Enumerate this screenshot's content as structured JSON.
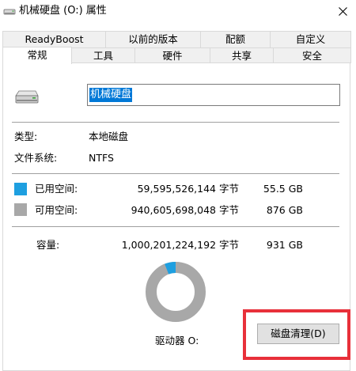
{
  "window": {
    "title": "机械硬盘 (O:) 属性"
  },
  "tabs": {
    "row1": [
      "ReadyBoost",
      "以前的版本",
      "配额",
      "自定义"
    ],
    "row2": [
      "常规",
      "工具",
      "硬件",
      "共享",
      "安全"
    ],
    "active": "常规"
  },
  "general": {
    "drive_name": "机械硬盘",
    "type_label": "类型:",
    "type_value": "本地磁盘",
    "fs_label": "文件系统:",
    "fs_value": "NTFS",
    "used_label": "已用空间:",
    "used_bytes": "59,595,526,144 字节",
    "used_size": "55.5 GB",
    "free_label": "可用空间:",
    "free_bytes": "940,605,698,048 字节",
    "free_size": "876 GB",
    "capacity_label": "容量:",
    "capacity_bytes": "1,000,201,224,192 字节",
    "capacity_size": "931 GB",
    "drive_letter_label": "驱动器 O:",
    "cleanup_button": "磁盘清理(D)",
    "used_fraction": 0.0596
  },
  "colors": {
    "used": "#1e9fe0",
    "free": "#a8a8a8",
    "highlight": "#e8303a",
    "selection": "#0078d7"
  }
}
